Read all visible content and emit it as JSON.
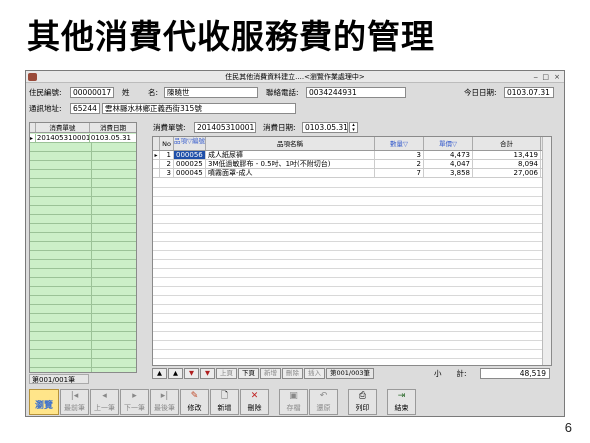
{
  "slide": {
    "title": "其他消費代收服務費的管理",
    "page_number": "6"
  },
  "window": {
    "title": "住民其他消費資料建立....<瀏覽作業處理中>",
    "min": "‒",
    "max": "□",
    "close": "×"
  },
  "header": {
    "resident_id_label": "住民編號:",
    "resident_id_value": "00000017",
    "surname_label": "姓",
    "name_label": "名:",
    "name_value": "陳曉世",
    "phone_label": "聯絡電話:",
    "phone_value": "0034244931",
    "today_label": "今日日期:",
    "today_value": "0103.07.31",
    "address_label": "通訊地址:",
    "postal_code": "65244",
    "address_value": "雲林縣水林鄉正義西街315號"
  },
  "left_grid": {
    "columns": [
      "消費單號",
      "消費日期"
    ],
    "rows": [
      {
        "marker": "▸",
        "order_no": "201405310001",
        "date": "0103.05.31"
      }
    ],
    "record_indicator": "第001/001筆"
  },
  "order": {
    "order_no_label": "消費單號:",
    "order_no_value": "201405310001",
    "date_label": "消費日期:",
    "date_value": "0103.05.31"
  },
  "items_grid": {
    "columns": {
      "no": "No",
      "code": "品項▽編號",
      "name": "品項名稱",
      "qty": "數量▽",
      "price": "單價▽",
      "total": "合計"
    },
    "rows": [
      {
        "marker": "▸",
        "no": "1",
        "code": "000056",
        "name": "成人紙尿褲",
        "qty": "3",
        "price": "4,473",
        "total": "13,419"
      },
      {
        "marker": "",
        "no": "2",
        "code": "000025",
        "name": "3M低過敏膠布 - 0.5吋、1吋(不附切台)",
        "qty": "2",
        "price": "4,047",
        "total": "8,094"
      },
      {
        "marker": "",
        "no": "3",
        "code": "000045",
        "name": "噴霧面罩-成人",
        "qty": "7",
        "price": "3,858",
        "total": "27,006"
      }
    ]
  },
  "nav": {
    "first": "▲",
    "prev": "▲",
    "next": "▼",
    "last": "▼",
    "top_label": "上頁",
    "down_label": "下頁",
    "add_label": "新增",
    "delete_label": "刪除",
    "insert_label": "插入",
    "record_indicator": "第001/003筆"
  },
  "subtotal": {
    "label": "小　　計:",
    "value": "48,519"
  },
  "toolbar": {
    "browse": {
      "label": "瀏覽",
      "icon": "browse-icon"
    },
    "first": {
      "label": "最前筆",
      "icon": "first-record-icon"
    },
    "prev": {
      "label": "上一筆",
      "icon": "prev-record-icon"
    },
    "next": {
      "label": "下一筆",
      "icon": "next-record-icon"
    },
    "last": {
      "label": "最後筆",
      "icon": "last-record-icon"
    },
    "edit": {
      "label": "修改",
      "icon": "edit-icon"
    },
    "add": {
      "label": "新增",
      "icon": "add-icon"
    },
    "delete": {
      "label": "刪除",
      "icon": "delete-icon"
    },
    "save": {
      "label": "存檔",
      "icon": "save-icon"
    },
    "restore": {
      "label": "還原",
      "icon": "restore-icon"
    },
    "print": {
      "label": "列印",
      "icon": "print-icon"
    },
    "exit": {
      "label": "結束",
      "icon": "exit-icon"
    }
  },
  "colors": {
    "left_grid_bg": "#ccefc8",
    "selected_cell": "#1f4fa8",
    "browse_button": "#ffe58a"
  }
}
